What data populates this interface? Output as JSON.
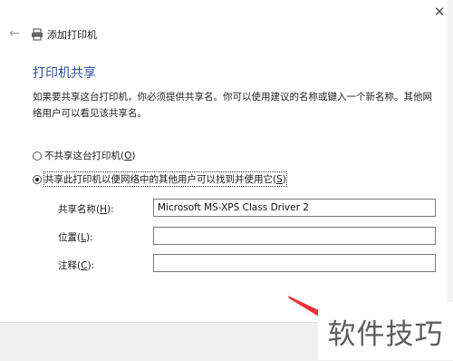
{
  "window": {
    "title": "添加打印机",
    "close_icon": "close-icon",
    "back_icon": "back-arrow-icon",
    "printer_icon": "printer-icon"
  },
  "page": {
    "heading": "打印机共享",
    "description": "如果要共享这台打印机，你必须提供共享名。你可以使用建议的名称或键入一个新名称。其他网络用户可以看见该共享名。"
  },
  "options": {
    "no_share": {
      "label": "不共享这台打印机(",
      "key": "O",
      "suffix": ")",
      "selected": false
    },
    "share": {
      "label": "共享此打印机以便网络中的其他用户可以找到并使用它(",
      "key": "S",
      "suffix": ")",
      "selected": true
    }
  },
  "fields": {
    "share_name": {
      "label": "共享名称(",
      "key": "H",
      "suffix": "):",
      "value": "Microsoft MS-XPS Class Driver 2"
    },
    "location": {
      "label": "位置(",
      "key": "L",
      "suffix": "):",
      "value": ""
    },
    "comment": {
      "label": "注释(",
      "key": "C",
      "suffix": "):",
      "value": ""
    }
  },
  "watermark": {
    "text": "软件技巧"
  },
  "colors": {
    "heading": "#2b4f9d",
    "pointer": "#e8313a",
    "footer": "#f0f0f0"
  }
}
